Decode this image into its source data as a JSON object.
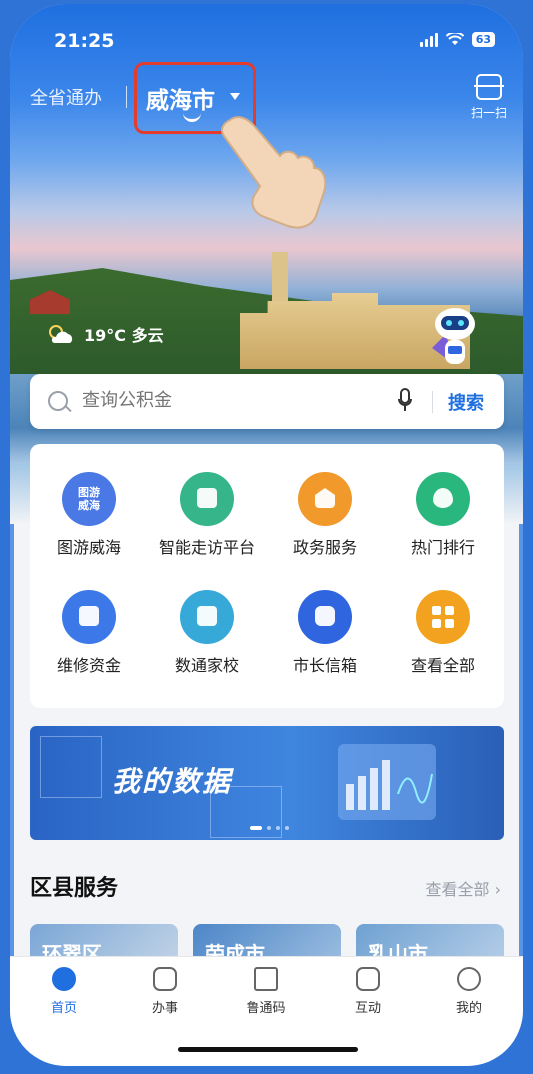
{
  "status": {
    "time": "21:25",
    "battery": "63"
  },
  "header": {
    "province": "全省通办",
    "city": "威海市",
    "scan_label": "扫一扫"
  },
  "weather": {
    "text": "19°C 多云"
  },
  "search": {
    "placeholder": "查询公积金",
    "button": "搜索"
  },
  "services": [
    {
      "label": "图游威海",
      "icon_text": "图游\n威海",
      "icon": "map-tour-icon",
      "color": "#4a79e6"
    },
    {
      "label": "智能走访平台",
      "icon": "visit-platform-icon",
      "color": "#36b58a"
    },
    {
      "label": "政务服务",
      "icon": "government-icon",
      "color": "#f19a2b"
    },
    {
      "label": "热门排行",
      "icon": "hot-ranking-icon",
      "color": "#2ab77e"
    },
    {
      "label": "维修资金",
      "icon": "repair-fund-icon",
      "color": "#3c78e8"
    },
    {
      "label": "数通家校",
      "icon": "home-school-icon",
      "color": "#36a9d8"
    },
    {
      "label": "市长信箱",
      "icon": "mayor-mailbox-icon",
      "color": "#2f66e0"
    },
    {
      "label": "查看全部",
      "icon": "all-apps-icon",
      "color": "#f2a21e"
    }
  ],
  "banner": {
    "title": "我的数据"
  },
  "districts": {
    "title": "区县服务",
    "more": "查看全部 ›",
    "items": [
      "环翠区",
      "荣成市",
      "乳山市"
    ]
  },
  "tabs": [
    {
      "label": "首页",
      "icon": "home-icon",
      "active": true
    },
    {
      "label": "办事",
      "icon": "task-icon",
      "active": false
    },
    {
      "label": "鲁通码",
      "icon": "qr-code-icon",
      "active": false
    },
    {
      "label": "互动",
      "icon": "chat-icon",
      "active": false
    },
    {
      "label": "我的",
      "icon": "profile-icon",
      "active": false
    }
  ]
}
